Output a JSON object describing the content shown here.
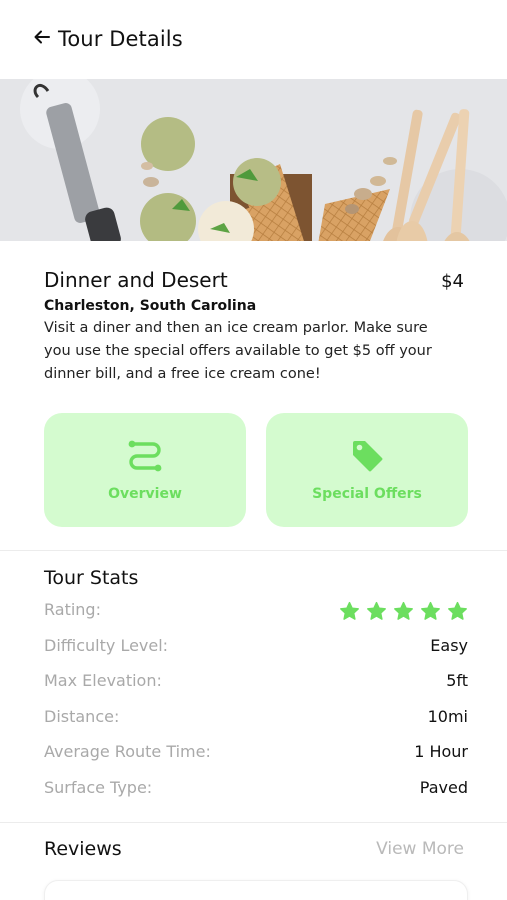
{
  "header": {
    "title": "Tour Details",
    "back_icon": "arrow-left-icon"
  },
  "hero": {
    "alt": "Ice cream cones with pistachio scoops and wooden spoons"
  },
  "tour": {
    "title": "Dinner and Desert",
    "price": "$4",
    "location": "Charleston, South Carolina",
    "description": "Visit a diner and then an ice cream parlor. Make sure you use the special offers available to get $5 off your dinner bill, and a free ice cream cone!"
  },
  "actions": [
    {
      "label": "Overview",
      "icon": "route-icon"
    },
    {
      "label": "Special Offers",
      "icon": "tag-icon"
    }
  ],
  "stats": {
    "title": "Tour Stats",
    "rating_label": "Rating:",
    "rating_value": 5,
    "rating_max": 5,
    "rows": [
      {
        "label": "Difficulty Level:",
        "value": "Easy"
      },
      {
        "label": "Max Elevation:",
        "value": "5ft"
      },
      {
        "label": "Distance:",
        "value": "10mi"
      },
      {
        "label": "Average Route Time:",
        "value": "1 Hour"
      },
      {
        "label": "Surface Type:",
        "value": "Paved"
      }
    ]
  },
  "reviews": {
    "title": "Reviews",
    "view_more": "View More"
  },
  "colors": {
    "accent_green": "#6cde5f",
    "card_green": "#d4fbcf",
    "muted_text": "#a9a9a9"
  }
}
